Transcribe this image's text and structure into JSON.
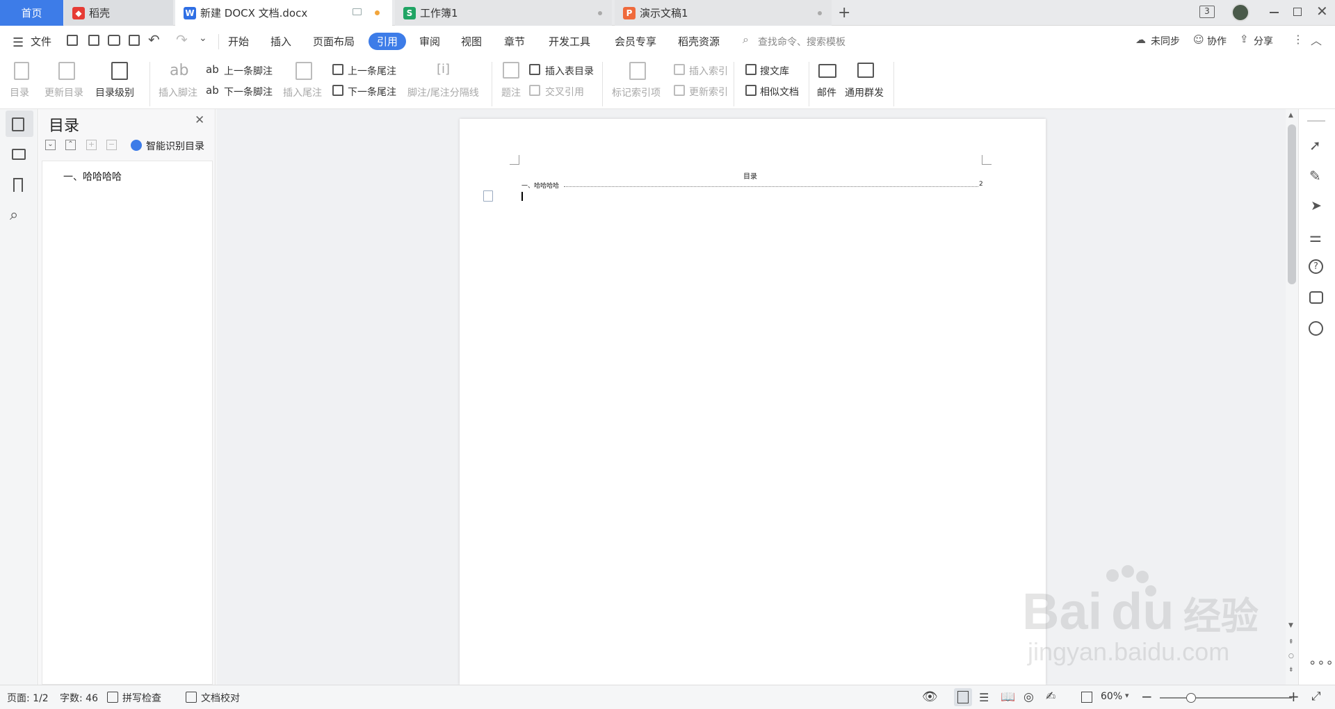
{
  "tabs": {
    "home": "首页",
    "daoke": "稻壳",
    "doc": "新建 DOCX 文档.docx",
    "xls": "工作簿1",
    "ppt": "演示文稿1",
    "badge": "3"
  },
  "menu": {
    "file": "文件",
    "items": [
      "开始",
      "插入",
      "页面布局",
      "引用",
      "审阅",
      "视图",
      "章节",
      "开发工具",
      "会员专享",
      "稻壳资源"
    ],
    "search_placeholder": "查找命令、搜索模板",
    "sync": "未同步",
    "collab": "协作",
    "share": "分享"
  },
  "ribbon": {
    "toc": "目录",
    "update_toc": "更新目录",
    "toc_level": "目录级别",
    "insert_footnote": "插入脚注",
    "prev_footnote": "上一条脚注",
    "next_footnote": "下一条脚注",
    "insert_endnote": "插入尾注",
    "prev_endnote": "上一条尾注",
    "next_endnote": "下一条尾注",
    "separator": "脚注/尾注分隔线",
    "caption": "题注",
    "insert_table_toc": "插入表目录",
    "cross_ref": "交叉引用",
    "mark_index": "标记索引项",
    "insert_index": "插入索引",
    "update_index": "更新索引",
    "search_lib": "搜文库",
    "similar_doc": "相似文档",
    "mail": "邮件",
    "mass_send": "通用群发"
  },
  "nav": {
    "title": "目录",
    "smart": "智能识别目录",
    "items": [
      "一、哈哈哈哈"
    ]
  },
  "document": {
    "toc_heading": "目录",
    "toc_entry": "一、哈哈哈哈",
    "toc_page": "2"
  },
  "status": {
    "page": "页面: 1/2",
    "words": "字数: 46",
    "spell": "拼写检查",
    "proof": "文档校对",
    "zoom": "60%"
  },
  "watermark": {
    "brand": "Bai",
    "brand2": "du",
    "cn": "经验",
    "url": "jingyan.baidu.com"
  },
  "colors": {
    "accent": "#3d7ce8",
    "daoke": "#e63b34",
    "word": "#2f6fe4",
    "excel": "#20a464",
    "ppt": "#ef6a3c"
  }
}
